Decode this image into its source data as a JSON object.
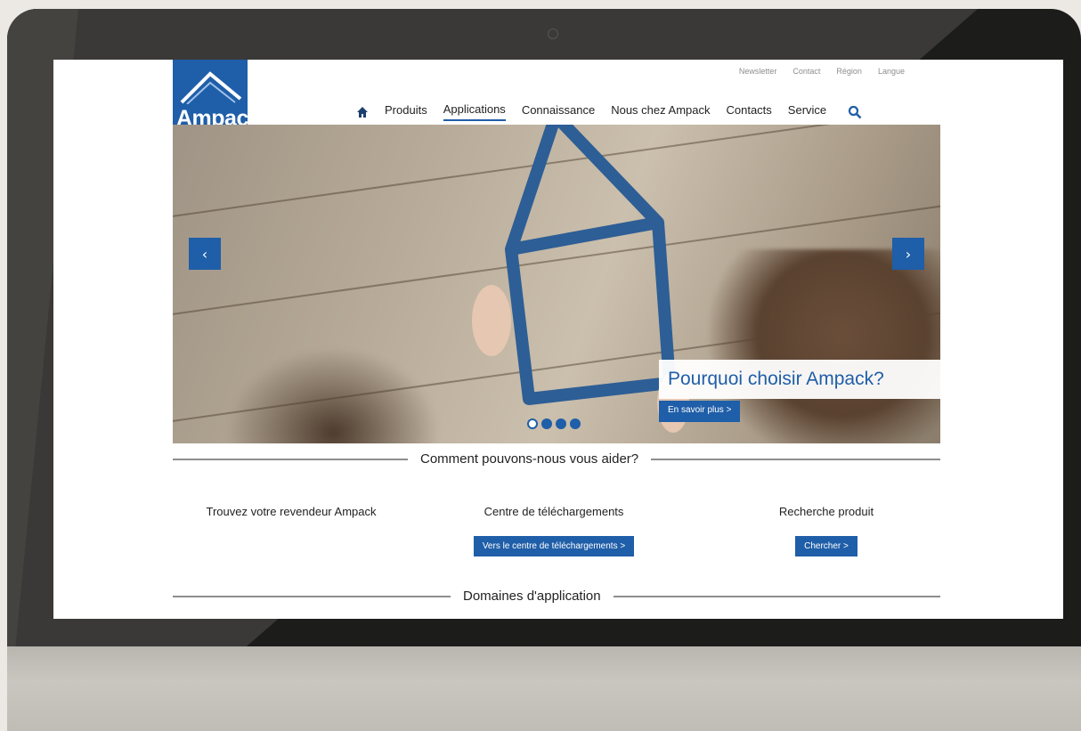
{
  "header": {
    "logo_text": "Ampack",
    "utility_links": [
      "Newsletter",
      "Contact",
      "Région",
      "Langue"
    ],
    "nav": {
      "home_icon": "home-icon",
      "items": [
        "Produits",
        "Applications",
        "Connaissance",
        "Nous chez Ampack",
        "Contacts",
        "Service"
      ],
      "active": "Applications",
      "search_icon": "search-icon"
    }
  },
  "hero": {
    "caption": "Pourquoi choisir Ampack?",
    "cta": "En savoir plus >",
    "prev": "‹",
    "next": "›",
    "dots_total": 4,
    "dot_active_index": 0
  },
  "help": {
    "title": "Comment pouvons-nous vous aider?",
    "columns": [
      {
        "heading": "Trouvez votre revendeur Ampack",
        "button": ""
      },
      {
        "heading": "Centre de téléchargements",
        "button": "Vers le centre de téléchargements >"
      },
      {
        "heading": "Recherche produit",
        "button": "Chercher >"
      }
    ]
  },
  "domains": {
    "title": "Domaines d'application"
  },
  "colors": {
    "brand_blue": "#1f5ea8",
    "frame": "#1c1c1a"
  }
}
